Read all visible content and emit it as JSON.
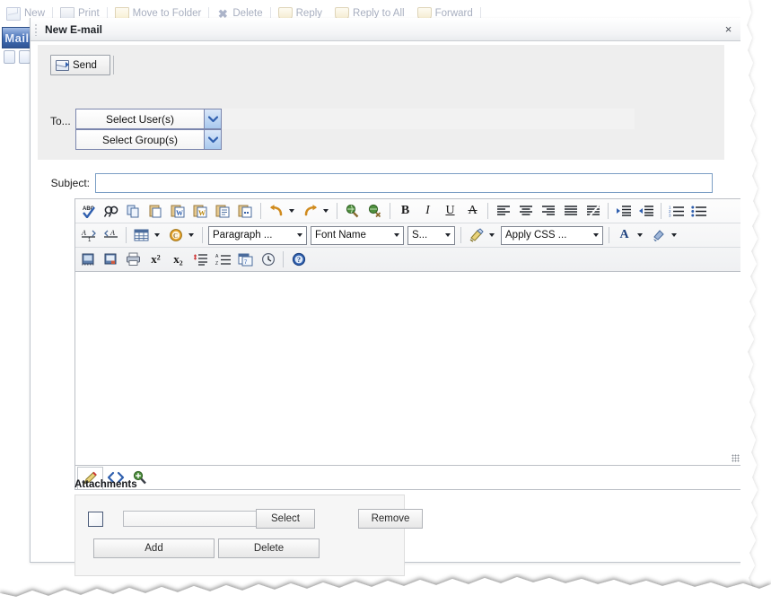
{
  "background": {
    "toolbar": [
      {
        "label": "New",
        "icon": "new-mail-icon"
      },
      {
        "label": "Print",
        "icon": "print-icon"
      },
      {
        "label": "Move to Folder",
        "icon": "folder-icon"
      },
      {
        "label": "Delete",
        "icon": "delete-icon"
      },
      {
        "label": "Reply",
        "icon": "reply-icon"
      },
      {
        "label": "Reply to All",
        "icon": "reply-all-icon"
      },
      {
        "label": "Forward",
        "icon": "forward-icon"
      }
    ],
    "nav_tab": "Mail"
  },
  "dialog": {
    "title": "New E-mail",
    "close_label": "×",
    "send_label": "Send",
    "to_label": "To...",
    "recipients": [
      {
        "value": "Select User(s)",
        "name": "select-users"
      },
      {
        "value": "Select Group(s)",
        "name": "select-groups"
      }
    ],
    "subject": {
      "label": "Subject:",
      "value": "",
      "placeholder": ""
    }
  },
  "editor": {
    "body_value": "",
    "toolbar_rows": [
      [
        {
          "name": "spellcheck-icon",
          "title": "Spell Check"
        },
        {
          "name": "find-icon",
          "title": "Find"
        },
        {
          "name": "copy-icon",
          "title": "Copy"
        },
        {
          "name": "paste-icon",
          "title": "Paste"
        },
        {
          "name": "paste-from-word-icon",
          "title": "Paste from Word"
        },
        {
          "name": "paste-from-word-clean-icon",
          "title": "Paste from Word, strip font"
        },
        {
          "name": "paste-plain-text-icon",
          "title": "Paste Plain Text"
        },
        {
          "name": "paste-as-html-icon",
          "title": "Paste as HTML"
        },
        {
          "name": "undo-icon",
          "title": "Undo"
        },
        {
          "name": "redo-icon",
          "title": "Redo"
        },
        {
          "name": "insert-link-icon",
          "title": "Insert Link"
        },
        {
          "name": "remove-link-icon",
          "title": "Remove Link"
        },
        {
          "name": "bold-icon",
          "title": "Bold",
          "glyph": "B"
        },
        {
          "name": "italic-icon",
          "title": "Italic",
          "glyph": "I"
        },
        {
          "name": "underline-icon",
          "title": "Underline",
          "glyph": "U"
        },
        {
          "name": "strikethrough-icon",
          "title": "Strikethrough",
          "glyph": "A"
        },
        {
          "name": "align-left-icon",
          "title": "Align Left"
        },
        {
          "name": "align-center-icon",
          "title": "Align Center"
        },
        {
          "name": "align-right-icon",
          "title": "Align Right"
        },
        {
          "name": "justify-icon",
          "title": "Justify"
        },
        {
          "name": "align-remove-icon",
          "title": "Remove Alignment"
        },
        {
          "name": "indent-increase-icon",
          "title": "Indent"
        },
        {
          "name": "indent-decrease-icon",
          "title": "Outdent"
        },
        {
          "name": "numbered-list-icon",
          "title": "Numbered List"
        },
        {
          "name": "bulleted-list-icon",
          "title": "Bulleted List"
        }
      ],
      [
        {
          "name": "decrease-indent-text-icon",
          "title": "Decrease Indent"
        },
        {
          "name": "increase-indent-text-icon",
          "title": "Increase Indent"
        },
        {
          "name": "insert-table-icon",
          "title": "Insert Table"
        },
        {
          "name": "insert-symbol-icon",
          "title": "Insert Symbol"
        }
      ],
      [
        {
          "name": "insert-image-icon",
          "title": "Insert Image"
        },
        {
          "name": "insert-media-icon",
          "title": "Insert Media"
        },
        {
          "name": "print-icon",
          "title": "Print"
        },
        {
          "name": "superscript-icon",
          "title": "Superscript",
          "glyph": "x²"
        },
        {
          "name": "subscript-icon",
          "title": "Subscript",
          "glyph": "x₂"
        },
        {
          "name": "format-marks-icon",
          "title": "Formatting Marks"
        },
        {
          "name": "sort-icon",
          "title": "Sort"
        },
        {
          "name": "insert-date-icon",
          "title": "Insert Date"
        },
        {
          "name": "insert-time-icon",
          "title": "Insert Time"
        },
        {
          "name": "help-icon",
          "title": "Help"
        }
      ]
    ],
    "combos": {
      "paragraph": "Paragraph ...",
      "font_name": "Font Name",
      "font_size": "S...",
      "apply_css": "Apply CSS ..."
    },
    "split_buttons": {
      "font_color": "A",
      "highlight": "highlight-icon",
      "format_painter": "format-painter-icon"
    },
    "footer_tabs": [
      {
        "name": "design-view-tab",
        "label": "Design"
      },
      {
        "name": "html-view-tab",
        "label": "HTML"
      },
      {
        "name": "preview-view-tab",
        "label": "Preview"
      }
    ]
  },
  "attachments": {
    "title": "Attachments",
    "file_value": "",
    "file_placeholder": "",
    "select_label": "Select",
    "remove_label": "Remove",
    "add_label": "Add",
    "delete_label": "Delete",
    "checkbox_checked": false
  },
  "colors": {
    "accent": "#2f5fae",
    "panel": "#eeeeee",
    "dialog_border": "#bfc5cc",
    "input_border": "#7b9ec4",
    "dropdown_border": "#7b86ad"
  }
}
